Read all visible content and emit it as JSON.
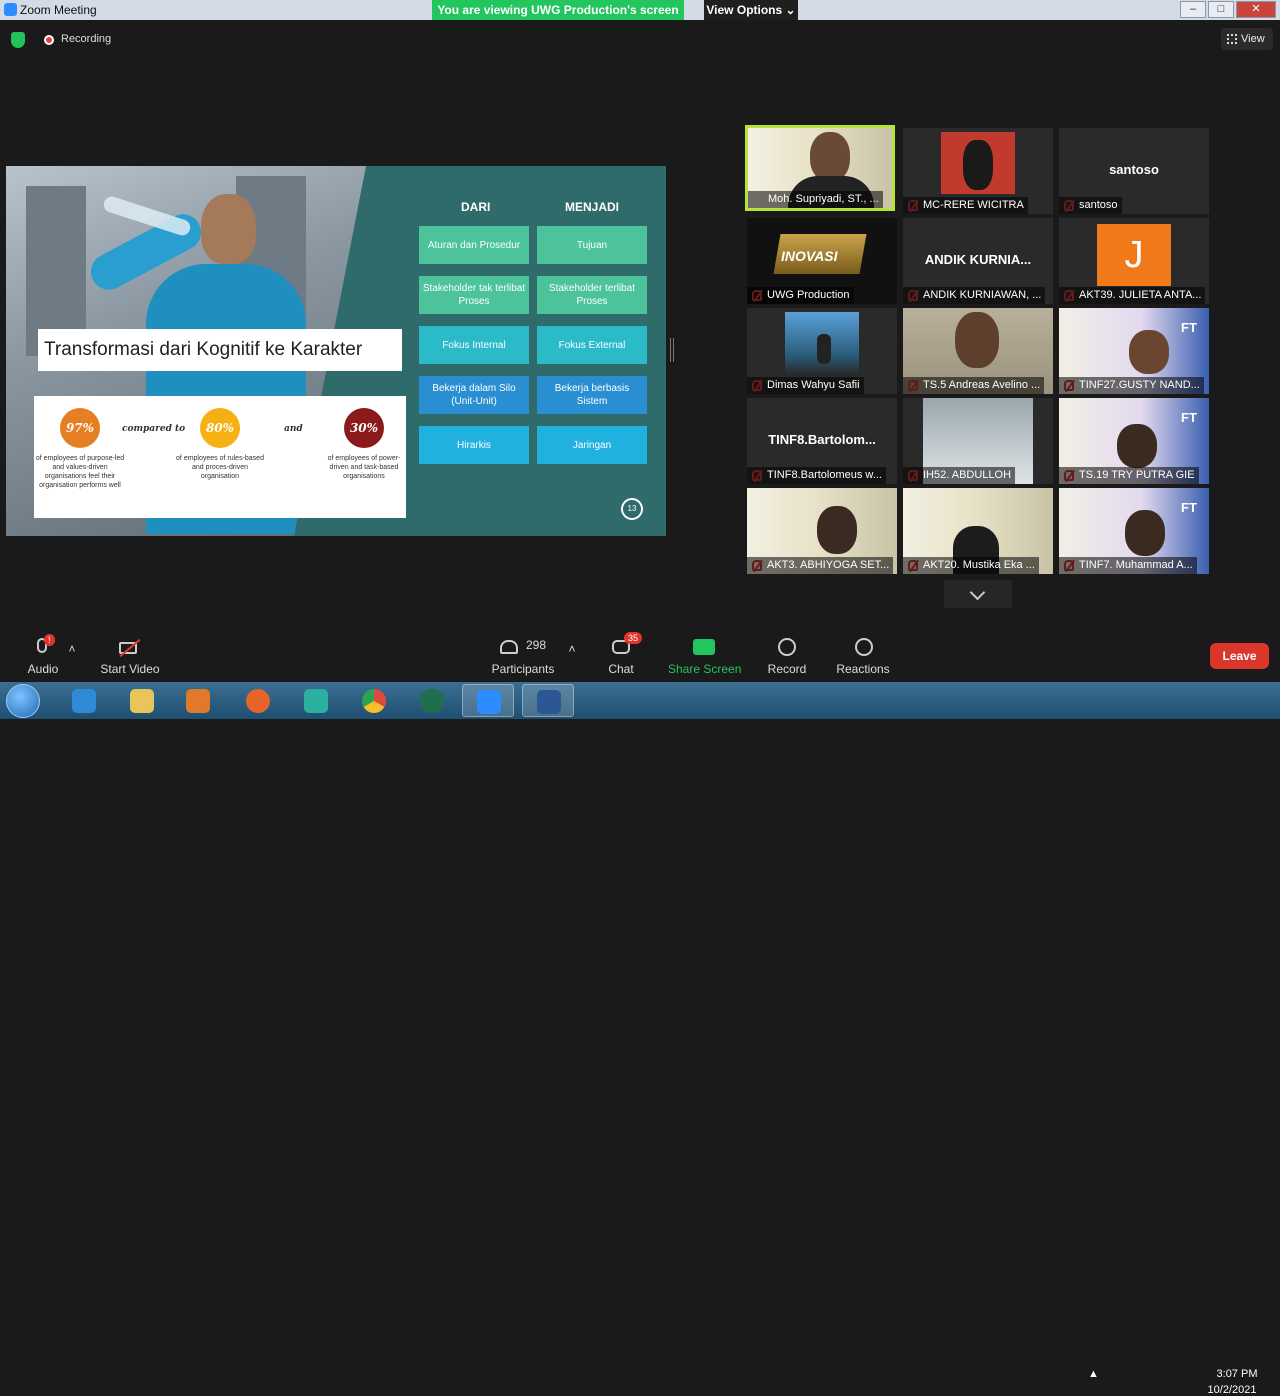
{
  "window": {
    "title": "Zoom Meeting"
  },
  "banner": {
    "viewing": "You are viewing UWG Production's screen",
    "view_options": "View Options"
  },
  "toolbar_top": {
    "recording": "Recording",
    "view": "View"
  },
  "slide": {
    "title": "Transformasi dari Kognitif ke Karakter",
    "col_from": "DARI",
    "col_to": "MENJADI",
    "rows": [
      {
        "from": "Aturan dan Prosedur",
        "to": "Tujuan"
      },
      {
        "from": "Stakeholder tak terlibat Proses",
        "to": "Stakeholder terlibat Proses"
      },
      {
        "from": "Fokus Internal",
        "to": "Fokus External"
      },
      {
        "from": "Bekerja dalam Silo (Unit-Unit)",
        "to": "Bekerja berbasis Sistem"
      },
      {
        "from": "Hirarkis",
        "to": "Jaringan"
      }
    ],
    "stats": [
      {
        "value": "97%",
        "desc": "of employees of purpose-led and values-driven organisations feel their organisation performs well",
        "color": "#e67e22"
      },
      {
        "value": "80%",
        "desc": "of employees of rules-based and proces-driven organisation",
        "color": "#f5b014"
      },
      {
        "value": "30%",
        "desc": "of employees of power-driven and task-based organisations",
        "color": "#8b1a1a"
      }
    ],
    "connector_1": "compared to",
    "connector_2": "and",
    "page_number": "13"
  },
  "participants_tiles": [
    {
      "name": "Moh. Supriyadi, ST., ...",
      "active": true
    },
    {
      "name": "MC-RERE WICITRA"
    },
    {
      "name": "santoso",
      "center": "santoso"
    },
    {
      "name": "UWG Production"
    },
    {
      "name": "ANDIK KURNIAWAN, ...",
      "center": "ANDIK KURNIA..."
    },
    {
      "name": "AKT39. JULIETA ANTA...",
      "avatar": "J"
    },
    {
      "name": "Dimas Wahyu Safii"
    },
    {
      "name": "TS.5 Andreas Avelino ..."
    },
    {
      "name": "TINF27.GUSTY NAND..."
    },
    {
      "name": "TINF8.Bartolomeus w...",
      "center": "TINF8.Bartolom..."
    },
    {
      "name": "IH52. ABDULLOH"
    },
    {
      "name": "TS.19 TRY PUTRA GIE"
    },
    {
      "name": "AKT3. ABHIYOGA SET..."
    },
    {
      "name": "AKT20. Mustika Eka ..."
    },
    {
      "name": "TINF7. Muhammad A..."
    }
  ],
  "controls": {
    "audio": "Audio",
    "start_video": "Start Video",
    "participants": "Participants",
    "participants_count": "298",
    "chat": "Chat",
    "chat_badge": "35",
    "share_screen": "Share Screen",
    "record": "Record",
    "reactions": "Reactions",
    "leave": "Leave"
  },
  "taskbar": {
    "time": "3:07 PM",
    "date": "10/2/2021"
  },
  "colors": {
    "share_green": "#22c55e",
    "leave_red": "#d9362c",
    "active_speaker": "#b6e23c"
  }
}
